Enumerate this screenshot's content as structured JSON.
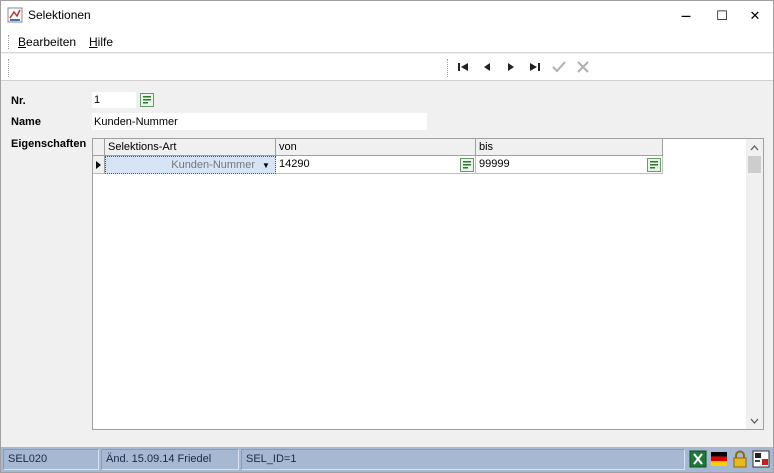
{
  "window": {
    "title": "Selektionen",
    "minimize_glyph": "—",
    "maximize_glyph": "☐",
    "close_glyph": "✕"
  },
  "menu": {
    "items": [
      {
        "underline": "B",
        "rest": "earbeiten"
      },
      {
        "underline": "H",
        "rest": "ilfe"
      }
    ]
  },
  "toolbar": {
    "icons": [
      "first-record-icon",
      "previous-record-icon",
      "next-record-icon",
      "last-record-icon",
      "confirm-check-icon",
      "cancel-x-icon"
    ]
  },
  "form": {
    "nr_label": "Nr.",
    "nr_value": "1",
    "name_label": "Name",
    "name_value": "Kunden-Nummer",
    "eigenschaften_label": "Eigenschaften"
  },
  "grid": {
    "columns": [
      "Selektions-Art",
      "von",
      "bis"
    ],
    "rows": [
      {
        "art": "Kunden-Nummer",
        "von": "14290",
        "bis": "99999"
      }
    ]
  },
  "status": {
    "code": "SEL020",
    "changed": "Änd. 15.09.14 Friedel",
    "id": "SEL_ID=1",
    "icons": [
      "excel-icon",
      "german-flag-icon",
      "lock-icon",
      "print-icon"
    ]
  },
  "colors": {
    "statusbar": "#a6b8d2",
    "selected_cell": "#d6e4f5",
    "lookup_green": "#3a8a3a"
  }
}
